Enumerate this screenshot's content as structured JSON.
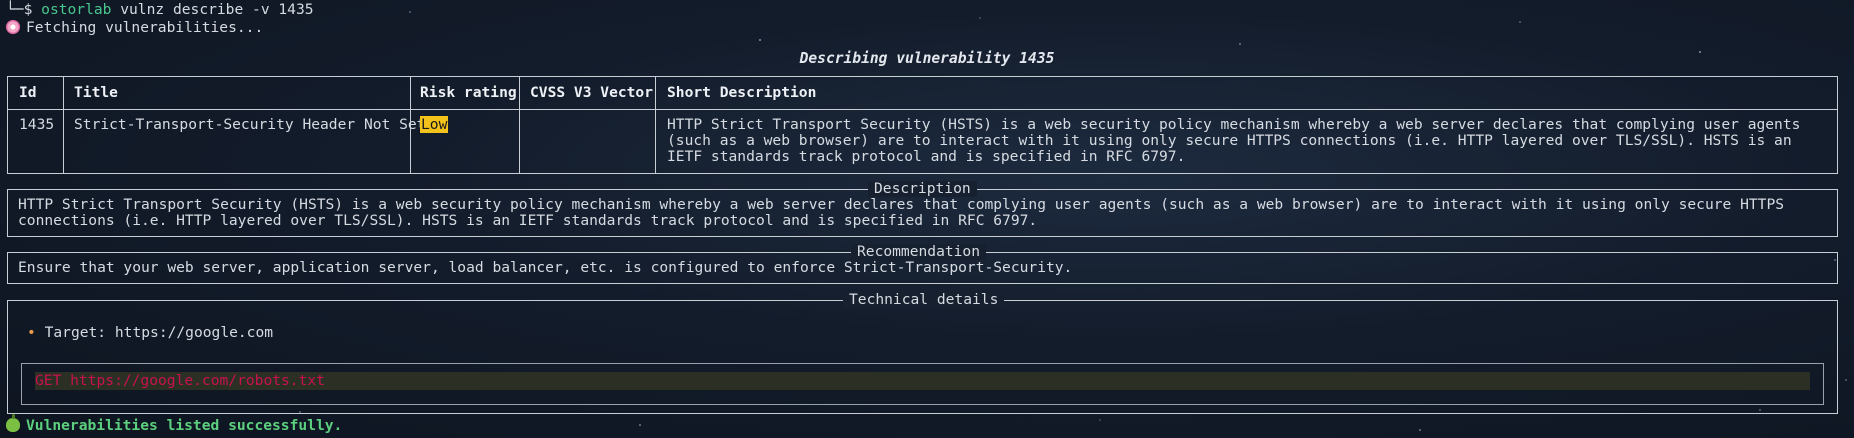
{
  "terminal": {
    "prompt_prefix": "└─$ ",
    "prompt_user": "ostorlab",
    "command": " vulnz describe -v 1435",
    "fetching_text": "Fetching vulnerabilities...",
    "success_text": "Vulnerabilities listed successfully."
  },
  "table": {
    "caption": "Describing vulnerability 1435",
    "headers": {
      "id": "Id",
      "title": "Title",
      "risk": "Risk rating",
      "cvss": "CVSS V3 Vector",
      "short": "Short Description"
    },
    "row": {
      "id": "1435",
      "title": "Strict-Transport-Security Header Not Set",
      "risk": "Low",
      "cvss": "",
      "short": "HTTP Strict Transport Security (HSTS) is a web security policy mechanism whereby a web server declares that complying user agents (such as a web browser) are to interact with it using only secure HTTPS connections (i.e. HTTP layered over TLS/SSL). HSTS is an IETF standards track protocol and is specified in RFC 6797."
    }
  },
  "description": {
    "title": "Description",
    "body": "HTTP Strict Transport Security (HSTS) is a web security policy mechanism whereby a web server declares that complying user agents (such as a web browser) are to interact with it using only secure HTTPS connections (i.e. HTTP layered over TLS/SSL). HSTS is an IETF standards track protocol and is specified in RFC 6797."
  },
  "recommendation": {
    "title": "Recommendation",
    "body": "Ensure that your web server, application server, load balancer, etc. is configured to enforce Strict-Transport-Security."
  },
  "technical": {
    "title": "Technical details",
    "bullet": "•",
    "target_label": "Target: https://google.com",
    "code": "GET https://google.com/robots.txt"
  },
  "colors": {
    "risk_low": "#f3c21b",
    "success": "#5cd07e",
    "code_text": "#c8124f"
  }
}
